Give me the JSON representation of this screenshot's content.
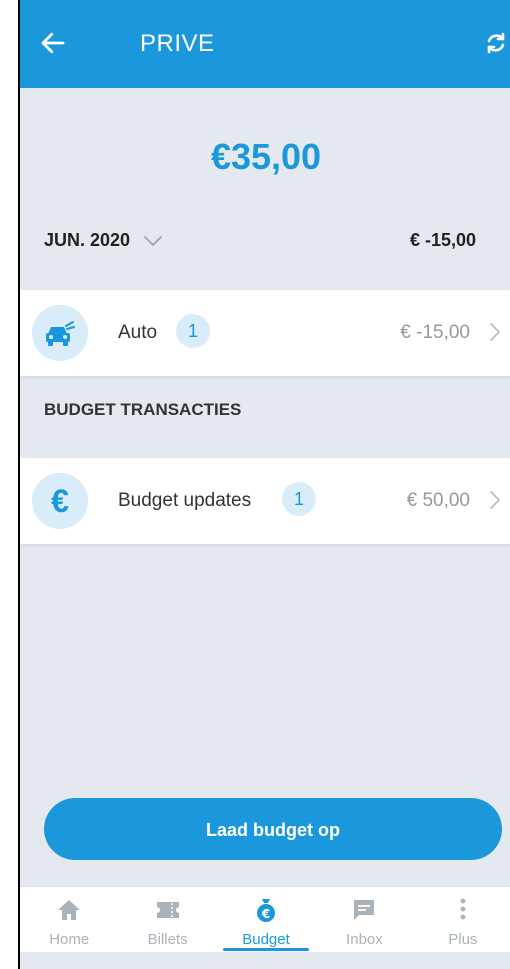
{
  "header": {
    "title": "PRIVE",
    "back_icon": "arrow-left-icon",
    "refresh_icon": "refresh-icon"
  },
  "summary": {
    "balance": "€35,00",
    "month": "JUN. 2020",
    "month_total": "€ -15,00"
  },
  "categories": [
    {
      "label": "Auto",
      "count": "1",
      "amount": "€ -15,00",
      "icon": "car-icon"
    }
  ],
  "transactions_section": {
    "heading": "BUDGET TRANSACTIES",
    "items": [
      {
        "label": "Budget updates",
        "count": "1",
        "amount": "€ 50,00",
        "icon": "euro-icon"
      }
    ]
  },
  "cta": {
    "label": "Laad budget op"
  },
  "bottom_nav": {
    "items": [
      {
        "label": "Home",
        "icon": "home-icon",
        "active": false
      },
      {
        "label": "Billets",
        "icon": "ticket-icon",
        "active": false
      },
      {
        "label": "Budget",
        "icon": "money-bag-icon",
        "active": true
      },
      {
        "label": "Inbox",
        "icon": "message-icon",
        "active": false
      },
      {
        "label": "Plus",
        "icon": "more-vertical-icon",
        "active": false
      }
    ]
  },
  "colors": {
    "primary": "#1a98db",
    "background": "#e3e9ee",
    "icon_bg": "#d8ecf9",
    "muted": "#aab3ba"
  }
}
